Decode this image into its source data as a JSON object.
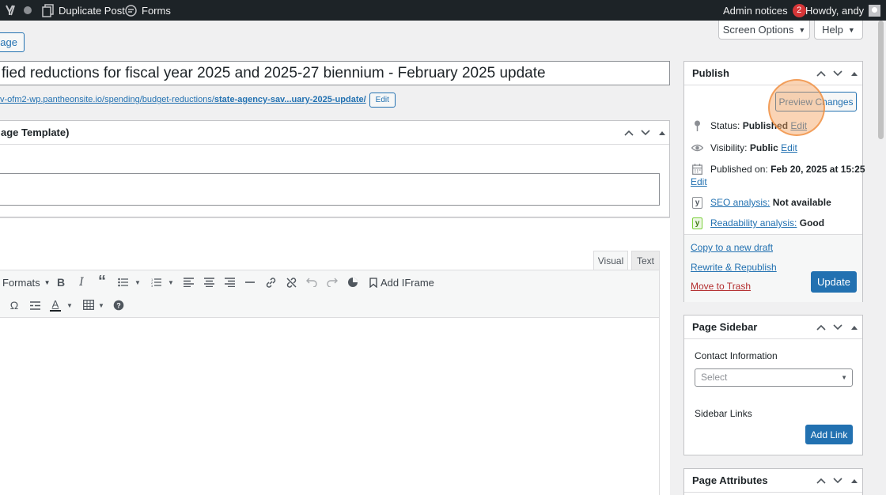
{
  "adminbar": {
    "duplicate_post": "Duplicate Post",
    "forms": "Forms",
    "admin_notices": "Admin notices",
    "notice_count": "2",
    "howdy": "Howdy, andy"
  },
  "header": {
    "add_page_partial": "Page",
    "screen_options": "Screen Options",
    "help": "Help"
  },
  "title": {
    "value": "fied reductions for fiscal year 2025 and 2025-27 biennium - February 2025 update"
  },
  "permalink": {
    "base": "v-ofm2-wp.pantheonsite.io/spending/budget-reductions/",
    "slug": "state-agency-sav...uary-2025-update/",
    "edit_label": "Edit"
  },
  "template_box": {
    "title": "age Template)"
  },
  "editor": {
    "tab_visual": "Visual",
    "tab_text": "Text",
    "formats_label": "Formats",
    "add_iframe_label": "Add IFrame"
  },
  "publish": {
    "title": "Publish",
    "preview_label": "Preview Changes",
    "status_label": "Status:",
    "status_value": "Published",
    "visibility_label": "Visibility:",
    "visibility_value": "Public",
    "published_on_label": "Published on:",
    "published_on_value": "Feb 20, 2025 at 15:25",
    "edit_label": "Edit",
    "seo_link": "SEO analysis:",
    "seo_value": "Not available",
    "readability_link": "Readability analysis:",
    "readability_value": "Good",
    "copy_draft": "Copy to a new draft",
    "rewrite": "Rewrite & Republish",
    "trash": "Move to Trash",
    "update": "Update"
  },
  "sidebar_box": {
    "title": "Page Sidebar",
    "contact_label": "Contact Information",
    "select_placeholder": "Select",
    "links_label": "Sidebar Links",
    "add_link": "Add Link"
  },
  "attributes_box": {
    "title": "Page Attributes"
  },
  "colors": {
    "primary": "#2271b1",
    "adminbar": "#1d2327",
    "notice": "#d63638",
    "trash": "#b32d2e"
  }
}
